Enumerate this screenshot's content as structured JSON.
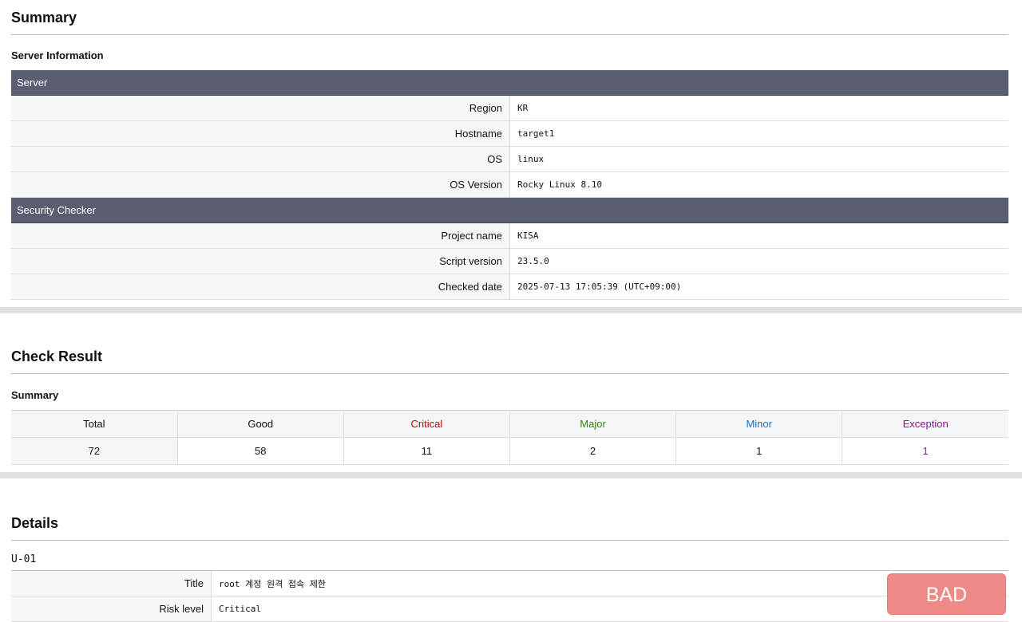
{
  "summary": {
    "title": "Summary",
    "server_info_heading": "Server Information",
    "server_group": "Server",
    "server_rows": [
      {
        "key": "Region",
        "value": "KR"
      },
      {
        "key": "Hostname",
        "value": "target1"
      },
      {
        "key": "OS",
        "value": "linux"
      },
      {
        "key": "OS Version",
        "value": "Rocky Linux 8.10"
      }
    ],
    "checker_group": "Security Checker",
    "checker_rows": [
      {
        "key": "Project name",
        "value": "KISA"
      },
      {
        "key": "Script version",
        "value": "23.5.0"
      },
      {
        "key": "Checked date",
        "value": "2025-07-13 17:05:39 (UTC+09:00)"
      }
    ]
  },
  "check_result": {
    "title": "Check Result",
    "summary_heading": "Summary",
    "columns": [
      {
        "label": "Total",
        "value": "72",
        "color": "#111111"
      },
      {
        "label": "Good",
        "value": "58",
        "color": "#111111"
      },
      {
        "label": "Critical",
        "value": "11",
        "color": "#cc0000"
      },
      {
        "label": "Major",
        "value": "2",
        "color": "#2e8b00"
      },
      {
        "label": "Minor",
        "value": "1",
        "color": "#1a73c8"
      },
      {
        "label": "Exception",
        "value": "1",
        "color": "#8b1a8b"
      }
    ]
  },
  "details": {
    "title": "Details",
    "item_id": "U-01",
    "rows": [
      {
        "key": "Title",
        "value": "root 계정 원격 접속 제한"
      },
      {
        "key": "Risk level",
        "value": "Critical"
      }
    ],
    "badge": "BAD",
    "badge_color": "#f08a88"
  }
}
